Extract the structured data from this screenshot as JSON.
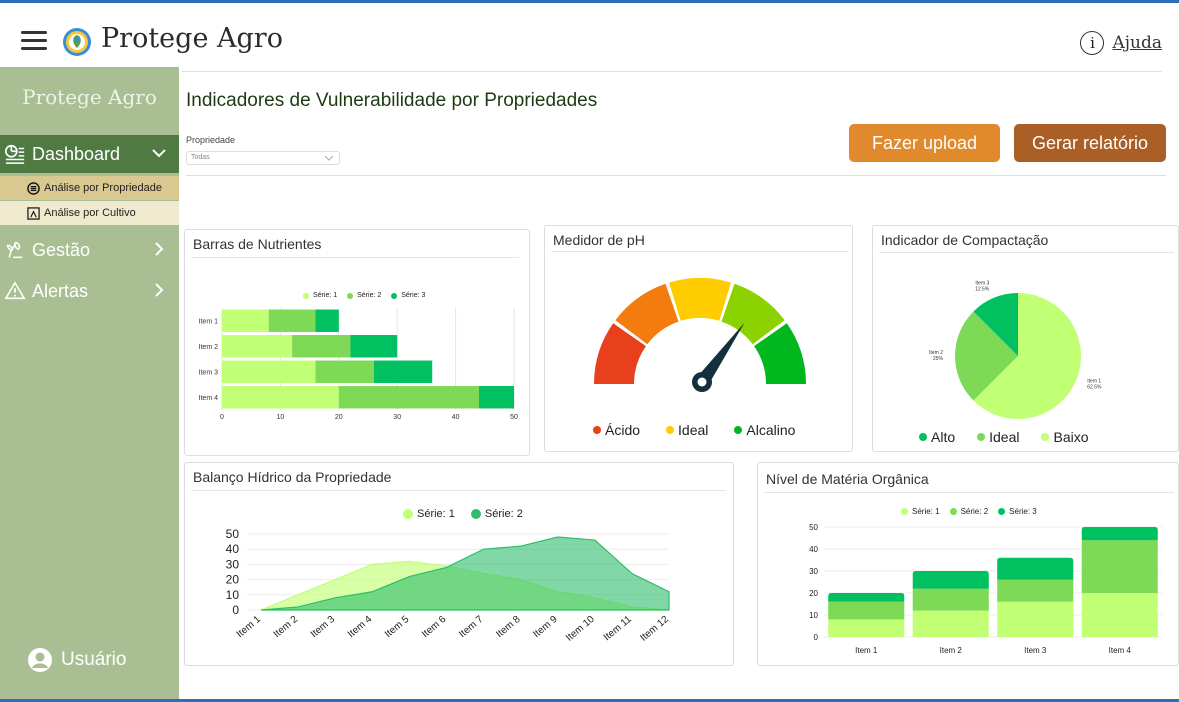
{
  "app": {
    "brand": "Protege Agro",
    "help_label": "Ajuda"
  },
  "sidebar": {
    "title": "Protege Agro",
    "items": [
      {
        "label": "Dashboard",
        "icon": "dashboard-icon"
      },
      {
        "label": "Gestão",
        "icon": "growth-icon"
      },
      {
        "label": "Alertas",
        "icon": "warning-icon"
      }
    ],
    "subitems": [
      {
        "label": "Análise por Propriedade",
        "icon": "property-icon"
      },
      {
        "label": "Análise por Cultivo",
        "icon": "crop-icon"
      }
    ],
    "user_label": "Usuário"
  },
  "main": {
    "title": "Indicadores de Vulnerabilidade por Propriedades",
    "filter": {
      "label": "Propriedade",
      "value": "Todas"
    },
    "upload_label": "Fazer upload",
    "report_label": "Gerar relatório"
  },
  "colors": {
    "accent": "#4f7a41",
    "sidebar": "#a9bf93",
    "upload": "#e08a2d",
    "report": "#a95f25"
  },
  "chart_data": [
    {
      "type": "bar",
      "orientation": "horizontal",
      "stacked": true,
      "title": "Barras de Nutrientes",
      "categories": [
        "Item 1",
        "Item 2",
        "Item 3",
        "Item 4"
      ],
      "series": [
        {
          "name": "Série: 1",
          "values": [
            8,
            12,
            16,
            20
          ],
          "color": "#c1ff75"
        },
        {
          "name": "Série: 2",
          "values": [
            8,
            10,
            10,
            24
          ],
          "color": "#7ed957"
        },
        {
          "name": "Série: 3",
          "values": [
            4,
            8,
            10,
            6
          ],
          "color": "#00c060"
        }
      ],
      "xlim": [
        0,
        50
      ],
      "xticks": [
        "0",
        "10",
        "20",
        "30",
        "40",
        "50"
      ],
      "grid": true,
      "legend": "top"
    },
    {
      "type": "gauge",
      "title": "Medidor de pH",
      "segments": [
        {
          "color": "#e8401c"
        },
        {
          "color": "#f47c0f"
        },
        {
          "color": "#ffcc00"
        },
        {
          "color": "#8cd200"
        },
        {
          "color": "#00b81e"
        }
      ],
      "needle": 0.7,
      "legend": [
        {
          "label": "Ácido",
          "color": "#e8401c"
        },
        {
          "label": "Ideal",
          "color": "#ffcc00"
        },
        {
          "label": "Alcalino",
          "color": "#00b81e"
        }
      ]
    },
    {
      "type": "pie",
      "title": "Indicador de Compactação",
      "slices": [
        {
          "label": "Item 1",
          "pct_label": "62.5%",
          "value": 62.5,
          "color": "#c1ff75"
        },
        {
          "label": "Item 2",
          "pct_label": "25%",
          "value": 25,
          "color": "#7ed957"
        },
        {
          "label": "Item 3",
          "pct_label": "12.5%",
          "value": 12.5,
          "color": "#00c060"
        }
      ],
      "legend": [
        {
          "label": "Alto",
          "color": "#00c060"
        },
        {
          "label": "Ideal",
          "color": "#7ed957"
        },
        {
          "label": "Baixo",
          "color": "#c1ff75"
        }
      ]
    },
    {
      "type": "area",
      "title": "Balanço Hídrico da Propriedade",
      "categories": [
        "Item 1",
        "Item 2",
        "Item 3",
        "Item 4",
        "Item 5",
        "Item 6",
        "Item 7",
        "Item 8",
        "Item 9",
        "Item 10",
        "Item 11",
        "Item 12"
      ],
      "series": [
        {
          "name": "Série: 1",
          "values": [
            0,
            10,
            20,
            30,
            32,
            29,
            24,
            20,
            12,
            8,
            2,
            0
          ],
          "color": "#c1ff75"
        },
        {
          "name": "Série: 2",
          "values": [
            0,
            2,
            8,
            12,
            22,
            28,
            40,
            42,
            48,
            46,
            24,
            12
          ],
          "color": "#2ebd6b"
        }
      ],
      "ylim": [
        0,
        50
      ],
      "yticks": [
        "0",
        "10",
        "20",
        "30",
        "40",
        "50"
      ],
      "grid": true,
      "legend": "top"
    },
    {
      "type": "bar",
      "stacked": true,
      "title": "Nível de Matéria Orgânica",
      "categories": [
        "Item 1",
        "Item 2",
        "Item 3",
        "Item 4"
      ],
      "series": [
        {
          "name": "Série: 1",
          "values": [
            8,
            12,
            16,
            20
          ],
          "color": "#c1ff75"
        },
        {
          "name": "Série: 2",
          "values": [
            8,
            10,
            10,
            24
          ],
          "color": "#7ed957"
        },
        {
          "name": "Série: 3",
          "values": [
            4,
            8,
            10,
            6
          ],
          "color": "#00c060"
        }
      ],
      "ylim": [
        0,
        50
      ],
      "yticks": [
        "0",
        "10",
        "20",
        "30",
        "40",
        "50"
      ],
      "grid": true,
      "legend": "top"
    }
  ]
}
